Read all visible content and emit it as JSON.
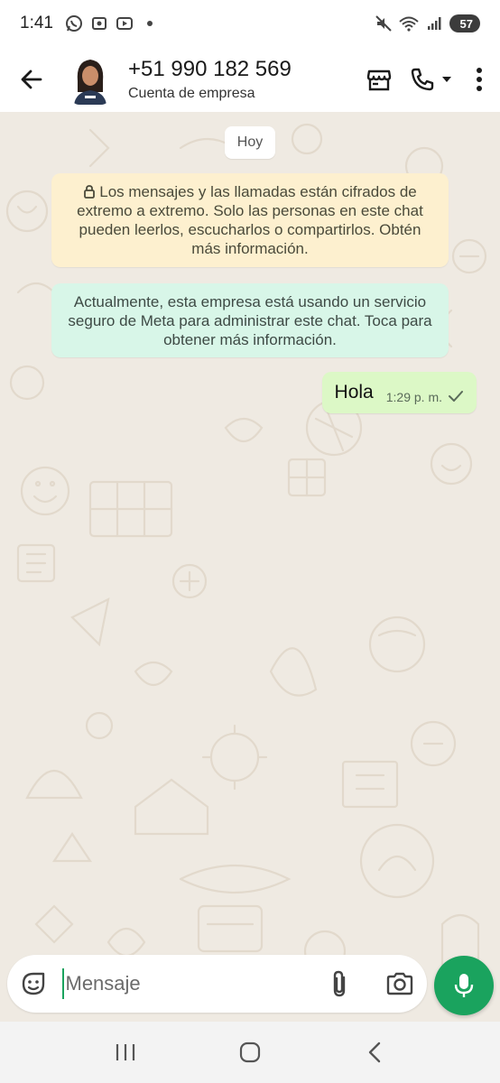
{
  "status_bar": {
    "time": "1:41",
    "battery": "57",
    "icons_left": [
      "whatsapp-icon",
      "screenshot-icon",
      "youtube-icon",
      "dot-icon"
    ],
    "icons_right": [
      "mute-icon",
      "wifi-5g-icon",
      "signal-icon",
      "battery-icon"
    ]
  },
  "header": {
    "contact_name": "+51 990 182 569",
    "contact_subtitle": "Cuenta de empresa",
    "icons": [
      "back-arrow-icon",
      "store-icon",
      "phone-icon",
      "dropdown-icon",
      "more-vert-icon"
    ]
  },
  "chat": {
    "date_chip": "Hoy",
    "encryption_notice": "Los mensajes y las llamadas están cifrados de extremo a extremo. Solo las personas en este chat pueden leerlos, escucharlos o compartirlos. Obtén más información.",
    "business_notice": "Actualmente, esta empresa está usando un servicio seguro de Meta para administrar este chat. Toca para obtener más información.",
    "messages": [
      {
        "text": "Hola",
        "time": "1:29 p. m.",
        "status": "sent"
      }
    ],
    "colors": {
      "background": "#efeae2",
      "outgoing_bubble": "#dcf8c6",
      "encryption_bg": "#fdf0cf",
      "business_bg": "#d8f6e8"
    }
  },
  "input": {
    "placeholder": "Mensaje",
    "icons": [
      "sticker-icon",
      "attach-icon",
      "camera-icon",
      "mic-icon"
    ],
    "accent": "#1aa35e"
  },
  "nav_bar": {
    "icons": [
      "recents-icon",
      "home-icon",
      "back-icon"
    ]
  }
}
